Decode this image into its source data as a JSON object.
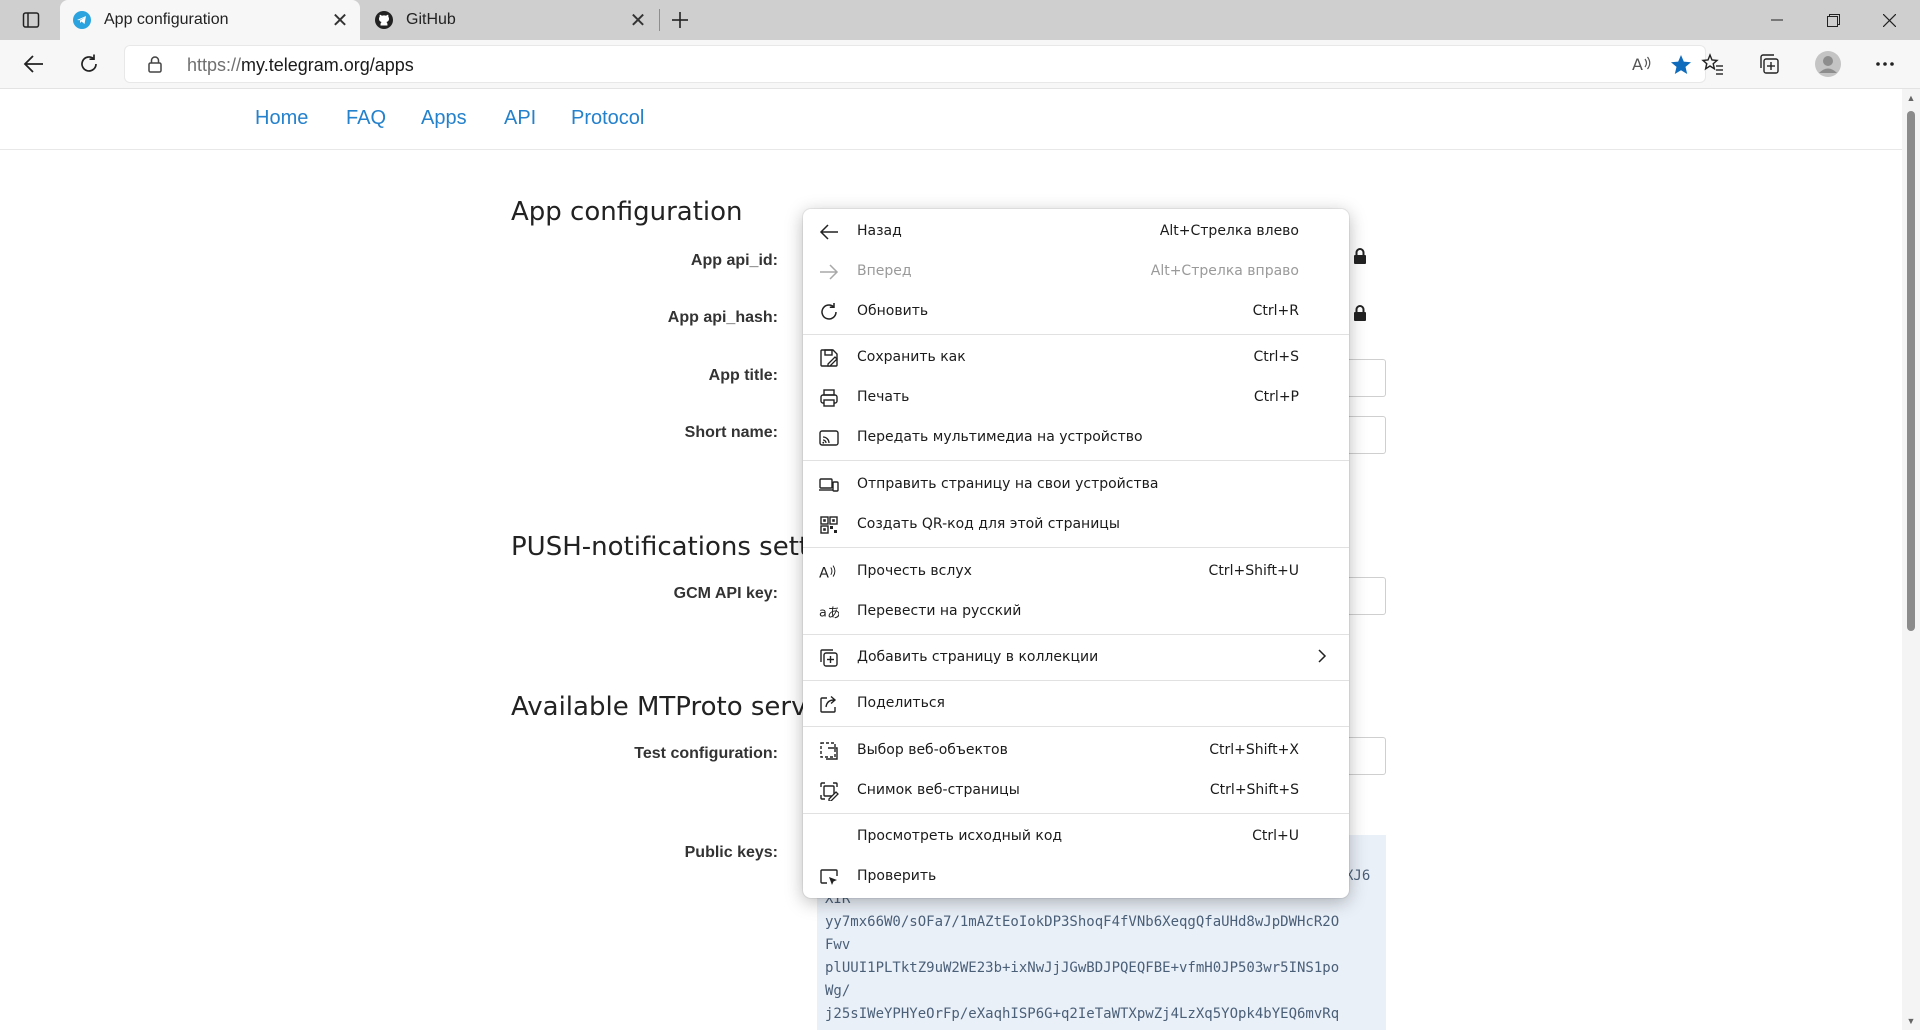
{
  "browser": {
    "tabs": [
      {
        "title": "App configuration",
        "icon": "telegram-icon",
        "active": true
      },
      {
        "title": "GitHub",
        "icon": "github-icon",
        "active": false
      }
    ],
    "address": {
      "protocol": "https://",
      "host_path": "my.telegram.org/apps"
    }
  },
  "site_nav": [
    "Home",
    "FAQ",
    "Apps",
    "API",
    "Protocol"
  ],
  "page": {
    "app_config_title": "App configuration",
    "labels": {
      "api_id": "App api_id:",
      "api_hash": "App api_hash:",
      "app_title": "App title:",
      "short_name": "Short name:",
      "gcm_key": "GCM API key:",
      "test_config": "Test configuration:",
      "public_keys": "Public keys:"
    },
    "push_title": "PUSH-notifications setti",
    "mtproto_title": "Available MTProto serve",
    "public_keys_lines": [
      "XIR",
      "yy7mx66W0/sOFa7/1mAZtEoIokDP3ShoqF4fVNb6XeqgQfaUHd8wJpDWHcR2O",
      "Fwv",
      "plUUI1PLTktZ9uW2WE23b+ixNwJjJGwBDJPQEQFBE+vfmH0JP503wr5INS1po",
      "Wg/",
      "j25sIWeYPHYeOrFp/eXaqhISP6G+q2IeTaWTXpwZj4LzXq5YOpk4bYEQ6mvRq"
    ],
    "public_keys_tail": "XJ6"
  },
  "context_menu": {
    "items": [
      {
        "label": "Назад",
        "shortcut": "Alt+Стрелка влево",
        "icon": "back-arrow-icon",
        "enabled": true
      },
      {
        "label": "Вперед",
        "shortcut": "Alt+Стрелка вправо",
        "icon": "forward-arrow-icon",
        "enabled": false
      },
      {
        "label": "Обновить",
        "shortcut": "Ctrl+R",
        "icon": "refresh-icon",
        "enabled": true
      },
      {
        "label": "Сохранить как",
        "shortcut": "Ctrl+S",
        "icon": "save-as-icon",
        "enabled": true
      },
      {
        "label": "Печать",
        "shortcut": "Ctrl+P",
        "icon": "print-icon",
        "enabled": true
      },
      {
        "label": "Передать мультимедиа на устройство",
        "shortcut": "",
        "icon": "cast-icon",
        "enabled": true
      },
      {
        "label": "Отправить страницу на свои устройства",
        "shortcut": "",
        "icon": "send-to-devices-icon",
        "enabled": true
      },
      {
        "label": "Создать QR-код для этой страницы",
        "shortcut": "",
        "icon": "qr-code-icon",
        "enabled": true
      },
      {
        "label": "Прочесть вслух",
        "shortcut": "Ctrl+Shift+U",
        "icon": "read-aloud-icon",
        "enabled": true
      },
      {
        "label": "Перевести на русский",
        "shortcut": "",
        "icon": "translate-icon",
        "enabled": true
      },
      {
        "label": "Добавить страницу в коллекции",
        "shortcut": "",
        "icon": "collections-icon",
        "enabled": true
      },
      {
        "label": "Поделиться",
        "shortcut": "",
        "icon": "share-icon",
        "enabled": true
      },
      {
        "label": "Выбор веб-объектов",
        "shortcut": "Ctrl+Shift+X",
        "icon": "web-select-icon",
        "enabled": true
      },
      {
        "label": "Снимок веб-страницы",
        "shortcut": "Ctrl+Shift+S",
        "icon": "web-capture-icon",
        "enabled": true
      },
      {
        "label": "Просмотреть исходный код",
        "shortcut": "Ctrl+U",
        "icon": "",
        "enabled": true
      },
      {
        "label": "Проверить",
        "shortcut": "",
        "icon": "inspect-icon",
        "enabled": true
      }
    ]
  },
  "colors": {
    "link": "#2481cc",
    "accent": "#0f6cbd",
    "keys_bg": "#eaf0f8"
  }
}
